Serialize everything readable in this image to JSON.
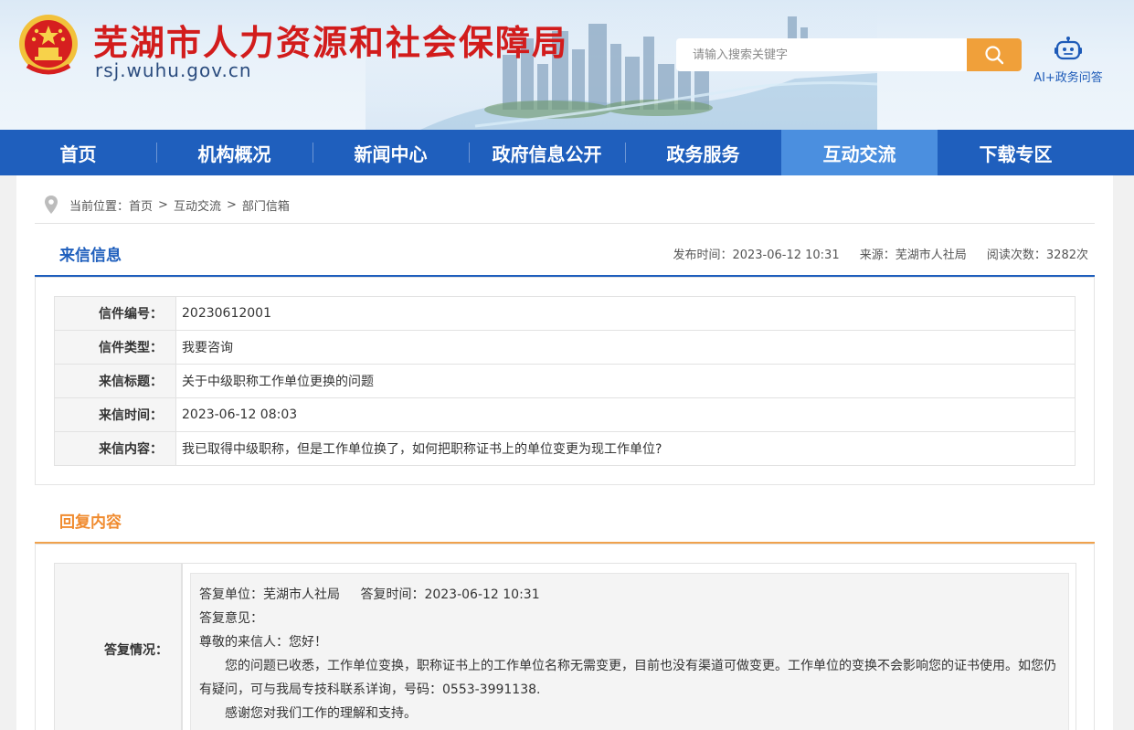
{
  "header": {
    "title": "芜湖市人力资源和社会保障局",
    "domain": "rsj.wuhu.gov.cn",
    "search_placeholder": "请输入搜索关键字",
    "ai_label": "AI+政务问答"
  },
  "nav": {
    "items": [
      {
        "label": "首页"
      },
      {
        "label": "机构概况"
      },
      {
        "label": "新闻中心"
      },
      {
        "label": "政府信息公开"
      },
      {
        "label": "政务服务"
      },
      {
        "label": "互动交流"
      },
      {
        "label": "下载专区"
      }
    ],
    "active_index": 5
  },
  "breadcrumb": {
    "prefix": "当前位置：",
    "items": [
      "首页",
      "互动交流",
      "部门信箱"
    ],
    "separator": ">"
  },
  "letter": {
    "section_title": "来信信息",
    "publish_time": "发布时间：2023-06-12 10:31",
    "source": "来源：芜湖市人社局",
    "views": "阅读次数：3282次",
    "rows": [
      {
        "key": "信件编号：",
        "value": "20230612001"
      },
      {
        "key": "信件类型：",
        "value": "我要咨询"
      },
      {
        "key": "来信标题：",
        "value": "关于中级职称工作单位更换的问题"
      },
      {
        "key": "来信时间：",
        "value": "2023-06-12 08:03"
      },
      {
        "key": "来信内容：",
        "value": "我已取得中级职称，但是工作单位换了，如何把职称证书上的单位变更为现工作单位?"
      }
    ]
  },
  "reply": {
    "section_title": "回复内容",
    "key": "答复情况：",
    "unit": "答复单位：芜湖市人社局",
    "time": "答复时间：2023-06-12 10:31",
    "opinion_label": "答复意见：",
    "greeting": "尊敬的来信人：您好！",
    "body": "您的问题已收悉，工作单位变换，职称证书上的工作单位名称无需变更，目前也没有渠道可做变更。工作单位的变换不会影响您的证书使用。如您仍有疑问，可与我局专技科联系详询，号码：0553-3991138.",
    "thanks": "感谢您对我们工作的理解和支持。"
  },
  "colors": {
    "nav_bg": "#1f5fbd",
    "nav_active": "#4b8fdf",
    "title_red": "#d21c1c",
    "section_blue": "#1f5fbd",
    "section_orange": "#f08b2f",
    "search_btn": "#f0a03a"
  },
  "icons": {
    "emblem": "national-emblem",
    "search": "search-icon",
    "ai": "robot-icon",
    "location": "location-pin-icon"
  }
}
